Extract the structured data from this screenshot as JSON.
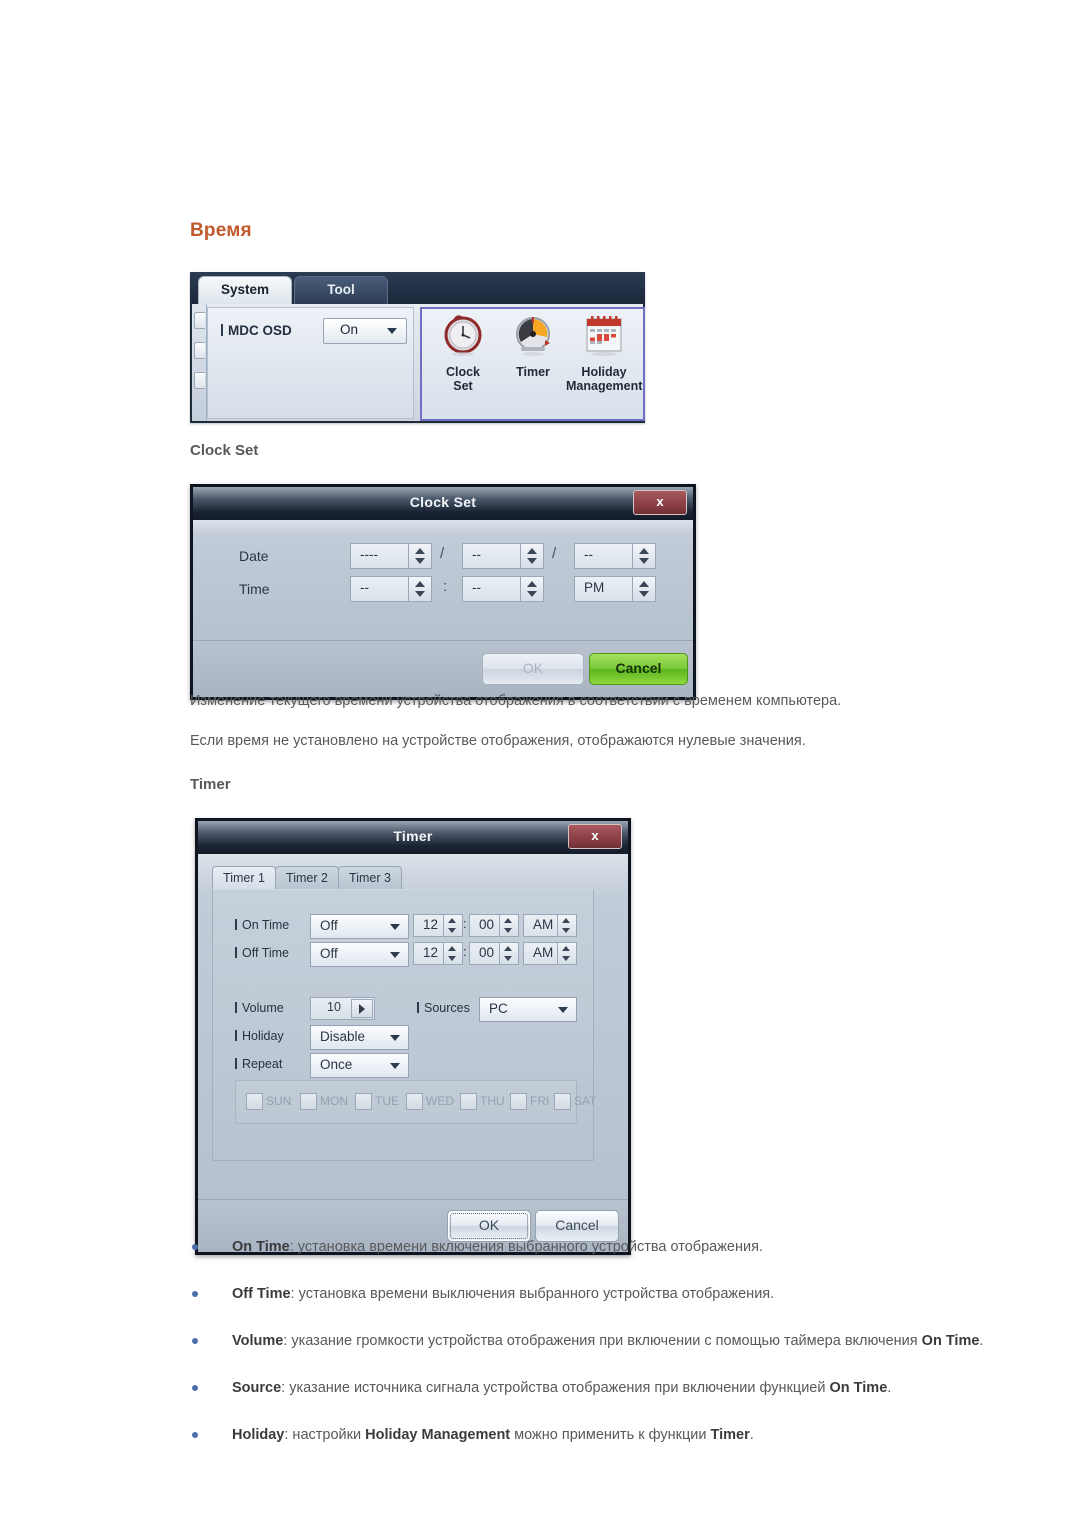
{
  "heading": "Время",
  "section_clock_label": "Clock Set",
  "section_timer_label": "Timer",
  "colors": {
    "heading": "#c0592c",
    "body_text": "#58595b",
    "bullet": "#4a6fa8",
    "cancel_green": "#7ac93a",
    "close_red": "#8d4147",
    "icon_pane_border": "#6f6fc4"
  },
  "paragraphs": {
    "p1": "Изменение текущего времени устройства отображения в соответствии с временем компьютера.",
    "p2": "Если время не установлено на устройстве отображения, отображаются нулевые значения."
  },
  "system_panel": {
    "tabs": [
      {
        "label": "System",
        "selected": true
      },
      {
        "label": "Tool",
        "selected": false
      }
    ],
    "setting": {
      "label": "MDC OSD",
      "value": "On",
      "caret_icon": "chevron-down-icon"
    },
    "icons": [
      {
        "icon": "clock-icon",
        "caption_line1": "Clock",
        "caption_line2": "Set"
      },
      {
        "icon": "timer-icon",
        "caption_line1": "Timer",
        "caption_line2": ""
      },
      {
        "icon": "calendar-icon",
        "caption_line1": "Holiday",
        "caption_line2": "Management"
      }
    ]
  },
  "clock_dialog": {
    "title": "Clock Set",
    "close_label": "x",
    "rows": [
      {
        "label": "Date",
        "fields": [
          {
            "value": "----",
            "name": "year-spinner"
          },
          {
            "value": "--",
            "name": "month-spinner"
          },
          {
            "value": "--",
            "name": "day-spinner"
          }
        ],
        "separators": [
          "/",
          "/"
        ]
      },
      {
        "label": "Time",
        "fields": [
          {
            "value": "--",
            "name": "hour-spinner"
          },
          {
            "value": "--",
            "name": "minute-spinner"
          },
          {
            "value": "PM",
            "name": "meridiem-spinner"
          }
        ],
        "separators": [
          ":"
        ]
      }
    ],
    "buttons": {
      "ok": "OK",
      "cancel": "Cancel",
      "ok_disabled": true
    }
  },
  "timer_dialog": {
    "title": "Timer",
    "close_label": "x",
    "tabs": [
      {
        "label": "Timer 1",
        "selected": true
      },
      {
        "label": "Timer 2",
        "selected": false
      },
      {
        "label": "Timer 3",
        "selected": false
      }
    ],
    "on_time": {
      "label": "On Time",
      "mode": "Off",
      "hour": "12",
      "minute": "00",
      "meridiem": "AM",
      "separator": ":"
    },
    "off_time": {
      "label": "Off Time",
      "mode": "Off",
      "hour": "12",
      "minute": "00",
      "meridiem": "AM",
      "separator": ":"
    },
    "volume": {
      "label": "Volume",
      "value": "10"
    },
    "sources": {
      "label": "Sources",
      "value": "PC"
    },
    "holiday": {
      "label": "Holiday",
      "value": "Disable"
    },
    "repeat": {
      "label": "Repeat",
      "value": "Once"
    },
    "days": [
      {
        "label": "SUN",
        "checked": false
      },
      {
        "label": "MON",
        "checked": false
      },
      {
        "label": "TUE",
        "checked": false
      },
      {
        "label": "WED",
        "checked": false
      },
      {
        "label": "THU",
        "checked": false
      },
      {
        "label": "FRI",
        "checked": false
      },
      {
        "label": "SAT",
        "checked": false
      }
    ],
    "buttons": {
      "ok": "OK",
      "cancel": "Cancel"
    }
  },
  "bullets": [
    {
      "term": "On Time",
      "rest": ": установка времени включения выбранного устройства отображения."
    },
    {
      "term": "Off Time",
      "rest": ": установка времени выключения выбранного устройства отображения."
    },
    {
      "term": "Volume",
      "rest": ": указание громкости устройства отображения при включении с помощью таймера включения ",
      "term2": "On Time",
      "tail": "."
    },
    {
      "term": "Source",
      "rest": ": указание источника сигнала устройства отображения при включении функцией ",
      "term2": "On Time",
      "tail": "."
    },
    {
      "term": "Holiday",
      "rest": ": настройки ",
      "term2": "Holiday Management",
      "mid": " можно применить к функции ",
      "term3": "Timer",
      "tail": "."
    }
  ]
}
